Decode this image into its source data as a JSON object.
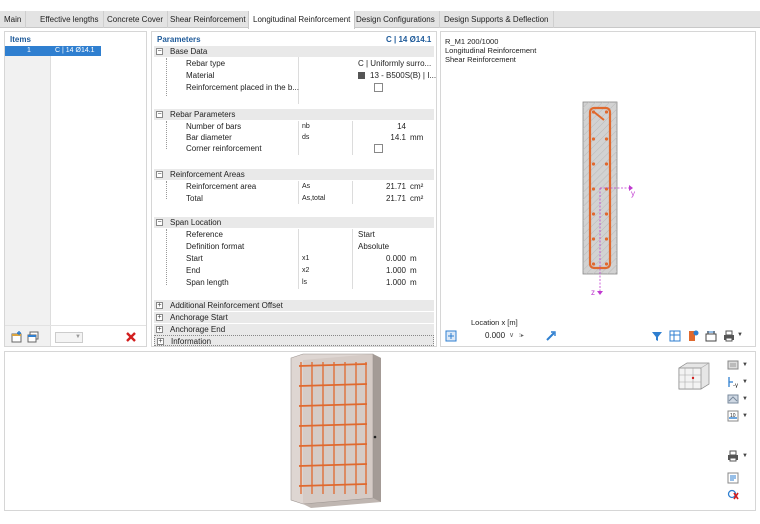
{
  "tabs": [
    "Main",
    "Effective lengths",
    "Concrete Cover",
    "Shear Reinforcement",
    "Longitudinal Reinforcement",
    "Design Configurations",
    "Design Supports & Deflection"
  ],
  "items": {
    "title": "Items",
    "rows": [
      {
        "id": "1",
        "label": "C | 14 Ø14.1"
      }
    ]
  },
  "parameters": {
    "title": "Parameters",
    "current": "C | 14 Ø14.1",
    "sections": {
      "base": {
        "title": "Base Data",
        "rebar_type_label": "Rebar type",
        "rebar_type_value": "C | Uniformly surro...",
        "material_label": "Material",
        "material_value": "13 - B500S(B) | I...",
        "placed_label": "Reinforcement placed in the b..."
      },
      "rebar": {
        "title": "Rebar Parameters",
        "bars_label": "Number of bars",
        "bars_sym": "nb",
        "bars_value": "14",
        "diam_label": "Bar diameter",
        "diam_sym": "ds",
        "diam_value": "14.1",
        "diam_unit": "mm",
        "corner_label": "Corner reinforcement"
      },
      "areas": {
        "title": "Reinforcement Areas",
        "area_label": "Reinforcement area",
        "area_sym": "As",
        "area_value": "21.71",
        "area_unit": "cm²",
        "total_label": "Total",
        "total_sym": "As,total",
        "total_value": "21.71",
        "total_unit": "cm²"
      },
      "span": {
        "title": "Span Location",
        "ref_label": "Reference",
        "ref_value": "Start",
        "def_label": "Definition format",
        "def_value": "Absolute",
        "start_label": "Start",
        "start_sym": "x1",
        "start_value": "0.000",
        "start_unit": "m",
        "end_label": "End",
        "end_sym": "x2",
        "end_value": "1.000",
        "end_unit": "m",
        "len_label": "Span length",
        "len_sym": "ls",
        "len_value": "1.000",
        "len_unit": "m"
      },
      "collapsed": [
        "Additional Reinforcement Offset",
        "Anchorage Start",
        "Anchorage End",
        "Information"
      ]
    }
  },
  "section_view": {
    "line1": "R_M1 200/1000",
    "line2": "Longitudinal Reinforcement",
    "line3": "Shear Reinforcement",
    "axis_y": "y",
    "axis_z": "z",
    "location_label": "Location x [m]",
    "location_value": "0.000"
  },
  "colors": {
    "accent": "#2f7fd0",
    "rebar": "#e0692e",
    "section_fill": "#cbcbcb",
    "axis": "#c03ad0"
  }
}
